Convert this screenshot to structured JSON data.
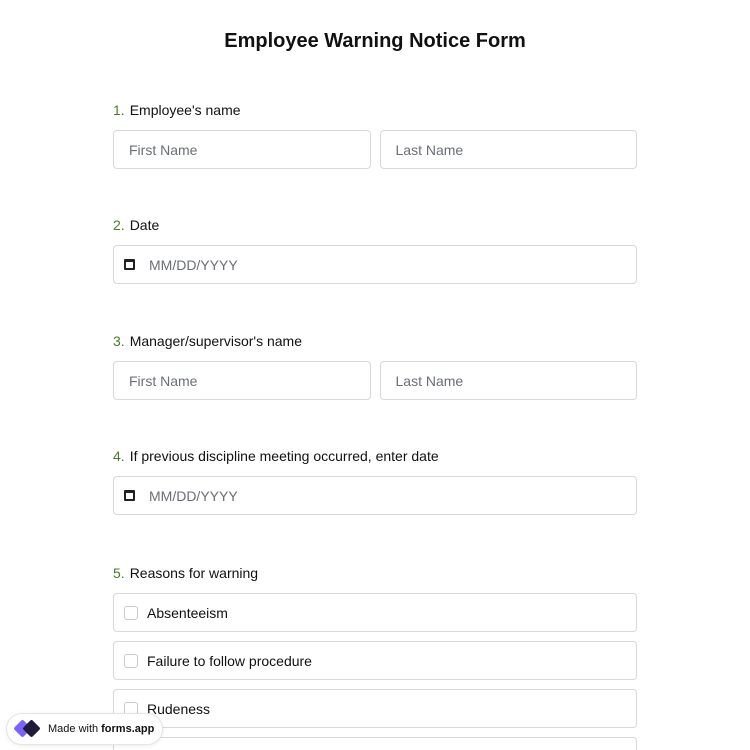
{
  "form": {
    "title": "Employee Warning Notice Form"
  },
  "questions": [
    {
      "number": "1.",
      "label": "Employee's name",
      "first_placeholder": "First Name",
      "last_placeholder": "Last Name"
    },
    {
      "number": "2.",
      "label": "Date",
      "placeholder": "MM/DD/YYYY"
    },
    {
      "number": "3.",
      "label": "Manager/supervisor's name",
      "first_placeholder": "First Name",
      "last_placeholder": "Last Name"
    },
    {
      "number": "4.",
      "label": "If previous discipline meeting occurred, enter date",
      "placeholder": "MM/DD/YYYY"
    },
    {
      "number": "5.",
      "label": "Reasons for warning",
      "options": [
        "Absenteeism",
        "Failure to follow procedure",
        "Rudeness"
      ]
    }
  ],
  "badge": {
    "prefix": "Made with",
    "brand": "forms.app"
  },
  "colors": {
    "number_accent": "#4b7a2a",
    "border": "#d6d8dc",
    "logo_primary": "#7b61ff",
    "logo_dark": "#1e1a3a"
  },
  "icons": {
    "date": "calendar-icon",
    "checkbox": "checkbox-empty",
    "logo": "forms-app-logo"
  }
}
